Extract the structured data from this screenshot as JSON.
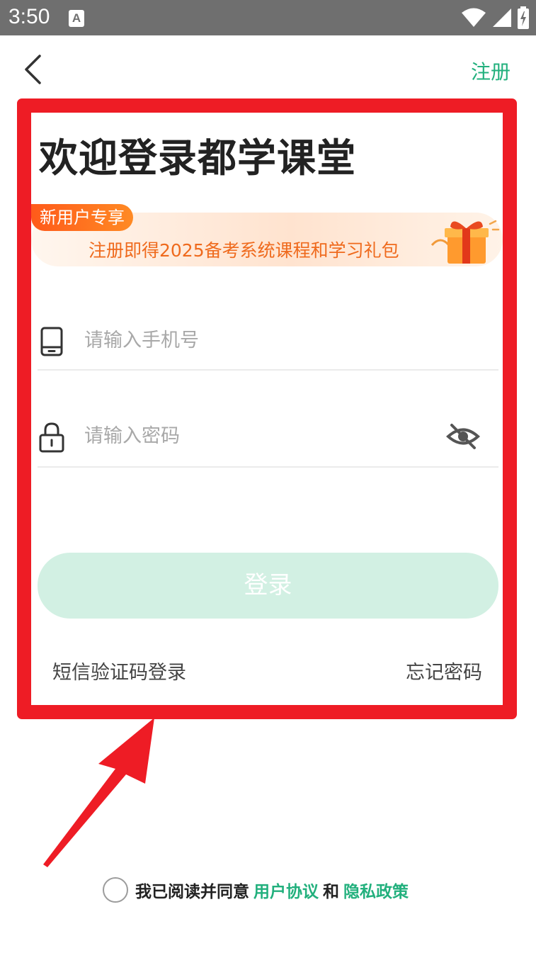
{
  "status_bar": {
    "time": "3:50",
    "notification_icon_letter": "A",
    "icons": [
      "wifi-icon",
      "signal-icon",
      "battery-charging-icon"
    ]
  },
  "header": {
    "back_icon": "chevron-left-icon",
    "register_label": "注册"
  },
  "login": {
    "title": "欢迎登录都学课堂",
    "promo": {
      "badge": "新用户专享",
      "text": "注册即得2025备考系统课程和学习礼包",
      "icon": "gift-box-icon"
    },
    "phone_field": {
      "placeholder": "请输入手机号",
      "value": "",
      "icon": "phone-icon"
    },
    "password_field": {
      "placeholder": "请输入密码",
      "value": "",
      "icon": "lock-icon",
      "visibility_icon": "eye-off-icon"
    },
    "submit_label": "登录",
    "sms_login_label": "短信验证码登录",
    "forgot_label": "忘记密码"
  },
  "agreement": {
    "prefix": "我已阅读并同意",
    "user_agreement": "用户协议",
    "and": "和",
    "privacy_policy": "隐私政策",
    "checked": false
  },
  "annotation": {
    "highlight_color": "#ee1c25"
  },
  "colors": {
    "accent": "#22b07d",
    "button_disabled": "#d2f0e3",
    "promo_orange": "#ef6a1d",
    "status_bar": "#6f6f6f"
  }
}
